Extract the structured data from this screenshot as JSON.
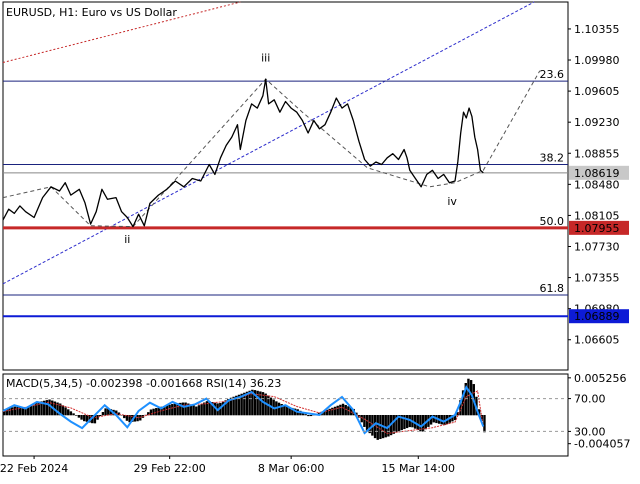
{
  "chart_data": {
    "type": "line",
    "title": "EURUSD, H1:  Euro vs US Dollar",
    "colors": {
      "price": "#000000",
      "wave": "#555555",
      "fib_line": "#1a237e",
      "fib_label": "#1a237e",
      "support": "#c62828",
      "level_blue": "#0d1bd6",
      "trend_blue": "#2d2dcc",
      "trend_red": "#c62828",
      "current": "#888888",
      "macd_hist": "#000000",
      "rsi": "#1e90ff",
      "signal": "#d32f2f"
    },
    "price_axis": {
      "range": [
        1.0624,
        1.1068
      ],
      "ticks": [
        "1.10355",
        "1.09980",
        "1.09605",
        "1.09230",
        "1.08855",
        "1.08480",
        "1.08105",
        "1.07730",
        "1.07355",
        "1.06980",
        "1.06605"
      ]
    },
    "time_axis": {
      "labels": [
        {
          "text": "22 Feb 2024",
          "pos": 0.055
        },
        {
          "text": "29 Feb 22:00",
          "pos": 0.295
        },
        {
          "text": "8 Mar 06:00",
          "pos": 0.51
        },
        {
          "text": "15 Mar 14:00",
          "pos": 0.735
        }
      ]
    },
    "price_series": [
      [
        0.0,
        1.0805
      ],
      [
        0.01,
        1.0818
      ],
      [
        0.02,
        1.0813
      ],
      [
        0.03,
        1.0822
      ],
      [
        0.04,
        1.0815
      ],
      [
        0.055,
        1.0808
      ],
      [
        0.07,
        1.0832
      ],
      [
        0.085,
        1.0845
      ],
      [
        0.1,
        1.084
      ],
      [
        0.11,
        1.085
      ],
      [
        0.12,
        1.0835
      ],
      [
        0.135,
        1.0842
      ],
      [
        0.145,
        1.0826
      ],
      [
        0.155,
        1.08
      ],
      [
        0.165,
        1.0815
      ],
      [
        0.175,
        1.0842
      ],
      [
        0.185,
        1.083
      ],
      [
        0.2,
        1.0832
      ],
      [
        0.21,
        1.0815
      ],
      [
        0.22,
        1.0808
      ],
      [
        0.23,
        1.0797
      ],
      [
        0.24,
        1.0812
      ],
      [
        0.25,
        1.0798
      ],
      [
        0.26,
        1.0825
      ],
      [
        0.275,
        1.0835
      ],
      [
        0.29,
        1.0842
      ],
      [
        0.305,
        1.0852
      ],
      [
        0.32,
        1.0845
      ],
      [
        0.335,
        1.0855
      ],
      [
        0.35,
        1.0852
      ],
      [
        0.365,
        1.0872
      ],
      [
        0.375,
        1.086
      ],
      [
        0.385,
        1.088
      ],
      [
        0.395,
        1.0895
      ],
      [
        0.405,
        1.0905
      ],
      [
        0.415,
        1.092
      ],
      [
        0.42,
        1.089
      ],
      [
        0.43,
        1.0925
      ],
      [
        0.44,
        1.0945
      ],
      [
        0.45,
        1.094
      ],
      [
        0.46,
        1.0955
      ],
      [
        0.465,
        1.0975
      ],
      [
        0.47,
        1.0945
      ],
      [
        0.48,
        1.095
      ],
      [
        0.49,
        1.0935
      ],
      [
        0.5,
        1.0948
      ],
      [
        0.51,
        1.094
      ],
      [
        0.52,
        1.0935
      ],
      [
        0.53,
        1.0925
      ],
      [
        0.54,
        1.091
      ],
      [
        0.55,
        1.0925
      ],
      [
        0.56,
        1.0915
      ],
      [
        0.57,
        1.092
      ],
      [
        0.58,
        1.0935
      ],
      [
        0.59,
        1.0952
      ],
      [
        0.6,
        1.094
      ],
      [
        0.61,
        1.0945
      ],
      [
        0.62,
        1.0925
      ],
      [
        0.63,
        1.09
      ],
      [
        0.64,
        1.0878
      ],
      [
        0.65,
        1.087
      ],
      [
        0.66,
        1.0875
      ],
      [
        0.67,
        1.0872
      ],
      [
        0.68,
        1.088
      ],
      [
        0.69,
        1.0885
      ],
      [
        0.7,
        1.0878
      ],
      [
        0.71,
        1.089
      ],
      [
        0.715,
        1.088
      ],
      [
        0.72,
        1.0865
      ],
      [
        0.73,
        1.0855
      ],
      [
        0.74,
        1.0845
      ],
      [
        0.75,
        1.086
      ],
      [
        0.76,
        1.0865
      ],
      [
        0.77,
        1.0855
      ],
      [
        0.78,
        1.086
      ],
      [
        0.79,
        1.085
      ],
      [
        0.8,
        1.0852
      ],
      [
        0.805,
        1.0875
      ],
      [
        0.81,
        1.091
      ],
      [
        0.815,
        1.0935
      ],
      [
        0.82,
        1.0928
      ],
      [
        0.825,
        1.094
      ],
      [
        0.83,
        1.093
      ],
      [
        0.835,
        1.0905
      ],
      [
        0.84,
        1.089
      ],
      [
        0.845,
        1.0865
      ],
      [
        0.85,
        1.0862
      ]
    ],
    "wave_path": [
      [
        0.0,
        1.0832
      ],
      [
        0.085,
        1.0845
      ],
      [
        0.155,
        1.0798
      ],
      [
        0.23,
        1.0797
      ],
      [
        0.465,
        1.0975
      ],
      [
        0.53,
        1.0935
      ],
      [
        0.645,
        1.0868
      ],
      [
        0.755,
        1.0845
      ],
      [
        0.8,
        1.085
      ],
      [
        0.85,
        1.0865
      ],
      [
        0.95,
        1.0985
      ]
    ],
    "wave_labels": [
      {
        "text": "ii",
        "x": 0.22,
        "y": 1.07775
      },
      {
        "text": "iii",
        "x": 0.465,
        "y": 1.0996
      },
      {
        "text": "iv",
        "x": 0.795,
        "y": 1.0823
      }
    ],
    "trend_blue": [
      [
        0.0,
        1.0728
      ],
      [
        0.94,
        1.1068
      ]
    ],
    "trend_red": [
      [
        0.0,
        1.0995
      ],
      [
        0.42,
        1.1068
      ]
    ],
    "fib_levels": [
      {
        "label": "23.6",
        "price": 1.09725
      },
      {
        "label": "38.2",
        "price": 1.0872
      },
      {
        "label": "50.0",
        "price": 1.07955
      },
      {
        "label": "61.8",
        "price": 1.07145
      }
    ],
    "support_level": {
      "price": 1.07955,
      "label": "1.07955"
    },
    "blue_level": {
      "price": 1.06889,
      "label": "1.06889"
    },
    "current_price": {
      "price": 1.08619,
      "label": "1.08619"
    },
    "indicator": {
      "label": "MACD(5,34,5) -0.002398 -0.001668 RSI(14) 36.23",
      "range": [
        -0.0058,
        0.0058
      ],
      "rsi_range": [
        0,
        100
      ],
      "ticks": [
        {
          "text": "0.005256",
          "value": 0.005256,
          "dashed": false
        },
        {
          "text": "70.00",
          "rsi": 70,
          "dashed": true
        },
        {
          "text": "30.00",
          "rsi": 30,
          "dashed": true
        },
        {
          "text": "-0.004057",
          "value": -0.004057,
          "dashed": false
        }
      ],
      "macd": [
        [
          0.0,
          0.0008
        ],
        [
          0.02,
          0.0012
        ],
        [
          0.04,
          0.001
        ],
        [
          0.06,
          0.0018
        ],
        [
          0.08,
          0.0022
        ],
        [
          0.1,
          0.0016
        ],
        [
          0.12,
          0.0004
        ],
        [
          0.14,
          -0.0008
        ],
        [
          0.16,
          -0.0012
        ],
        [
          0.18,
          0.001
        ],
        [
          0.2,
          0.0006
        ],
        [
          0.22,
          -0.001
        ],
        [
          0.24,
          -0.0008
        ],
        [
          0.26,
          0.0008
        ],
        [
          0.28,
          0.0012
        ],
        [
          0.3,
          0.0016
        ],
        [
          0.32,
          0.0018
        ],
        [
          0.34,
          0.0012
        ],
        [
          0.36,
          0.002
        ],
        [
          0.38,
          0.0016
        ],
        [
          0.4,
          0.0024
        ],
        [
          0.42,
          0.003
        ],
        [
          0.44,
          0.0036
        ],
        [
          0.46,
          0.0032
        ],
        [
          0.48,
          0.002
        ],
        [
          0.5,
          0.0012
        ],
        [
          0.52,
          0.0008
        ],
        [
          0.54,
          -0.0002
        ],
        [
          0.56,
          0.0004
        ],
        [
          0.58,
          0.001
        ],
        [
          0.6,
          0.0016
        ],
        [
          0.62,
          0.0008
        ],
        [
          0.64,
          -0.002
        ],
        [
          0.66,
          -0.0035
        ],
        [
          0.68,
          -0.003
        ],
        [
          0.7,
          -0.0022
        ],
        [
          0.72,
          -0.0016
        ],
        [
          0.74,
          -0.0024
        ],
        [
          0.76,
          -0.001
        ],
        [
          0.78,
          -0.0014
        ],
        [
          0.8,
          -0.0006
        ],
        [
          0.81,
          0.003
        ],
        [
          0.82,
          0.0052
        ],
        [
          0.83,
          0.0048
        ],
        [
          0.84,
          0.001
        ],
        [
          0.85,
          -0.0024
        ]
      ],
      "signal": [
        [
          0.0,
          0.0005
        ],
        [
          0.04,
          0.0011
        ],
        [
          0.08,
          0.0018
        ],
        [
          0.12,
          0.001
        ],
        [
          0.16,
          -0.0004
        ],
        [
          0.2,
          0.0002
        ],
        [
          0.24,
          -0.0004
        ],
        [
          0.28,
          0.0006
        ],
        [
          0.32,
          0.0014
        ],
        [
          0.36,
          0.0016
        ],
        [
          0.4,
          0.002
        ],
        [
          0.44,
          0.003
        ],
        [
          0.48,
          0.0026
        ],
        [
          0.52,
          0.0012
        ],
        [
          0.56,
          0.0003
        ],
        [
          0.6,
          0.0011
        ],
        [
          0.64,
          -0.0006
        ],
        [
          0.68,
          -0.0026
        ],
        [
          0.72,
          -0.0022
        ],
        [
          0.76,
          -0.0018
        ],
        [
          0.8,
          -0.001
        ],
        [
          0.82,
          0.0026
        ],
        [
          0.84,
          0.0034
        ],
        [
          0.85,
          -0.0017
        ]
      ],
      "rsi": [
        [
          0.0,
          55
        ],
        [
          0.02,
          62
        ],
        [
          0.04,
          58
        ],
        [
          0.06,
          66
        ],
        [
          0.08,
          63
        ],
        [
          0.1,
          52
        ],
        [
          0.12,
          42
        ],
        [
          0.14,
          34
        ],
        [
          0.16,
          48
        ],
        [
          0.18,
          62
        ],
        [
          0.2,
          50
        ],
        [
          0.22,
          35
        ],
        [
          0.24,
          55
        ],
        [
          0.26,
          65
        ],
        [
          0.28,
          58
        ],
        [
          0.3,
          66
        ],
        [
          0.32,
          60
        ],
        [
          0.34,
          63
        ],
        [
          0.36,
          70
        ],
        [
          0.38,
          56
        ],
        [
          0.4,
          68
        ],
        [
          0.42,
          72
        ],
        [
          0.44,
          78
        ],
        [
          0.46,
          66
        ],
        [
          0.48,
          58
        ],
        [
          0.5,
          62
        ],
        [
          0.52,
          54
        ],
        [
          0.54,
          52
        ],
        [
          0.56,
          50
        ],
        [
          0.58,
          62
        ],
        [
          0.6,
          72
        ],
        [
          0.62,
          56
        ],
        [
          0.64,
          28
        ],
        [
          0.66,
          40
        ],
        [
          0.68,
          34
        ],
        [
          0.7,
          48
        ],
        [
          0.72,
          44
        ],
        [
          0.74,
          36
        ],
        [
          0.76,
          48
        ],
        [
          0.78,
          42
        ],
        [
          0.8,
          50
        ],
        [
          0.81,
          66
        ],
        [
          0.82,
          84
        ],
        [
          0.83,
          74
        ],
        [
          0.84,
          54
        ],
        [
          0.85,
          36
        ]
      ]
    }
  }
}
